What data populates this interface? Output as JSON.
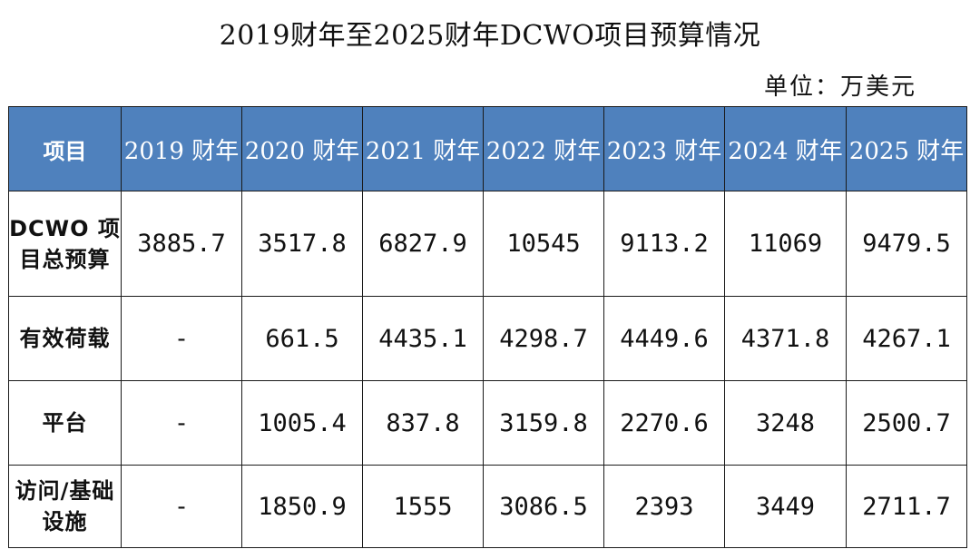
{
  "title": "2019财年至2025财年DCWO项目预算情况",
  "unit_label": "单位：万美元",
  "table": {
    "header": [
      "项目",
      "2019 财年",
      "2020 财年",
      "2021 财年",
      "2022 财年",
      "2023 财年",
      "2024 财年",
      "2025 财年"
    ],
    "rows": [
      {
        "label": "DCWO 项目总预算",
        "values": [
          "3885.7",
          "3517.8",
          "6827.9",
          "10545",
          "9113.2",
          "11069",
          "9479.5"
        ]
      },
      {
        "label": "有效荷载",
        "values": [
          "-",
          "661.5",
          "4435.1",
          "4298.7",
          "4449.6",
          "4371.8",
          "4267.1"
        ]
      },
      {
        "label": "平台",
        "values": [
          "-",
          "1005.4",
          "837.8",
          "3159.8",
          "2270.6",
          "3248",
          "2500.7"
        ]
      },
      {
        "label": "访问/基础设施",
        "values": [
          "-",
          "1850.9",
          "1555",
          "3086.5",
          "2393",
          "3449",
          "2711.7"
        ]
      }
    ]
  },
  "colors": {
    "header_bg": "#4f81bd",
    "header_text": "#ffffff",
    "border": "#1a1a1a"
  }
}
